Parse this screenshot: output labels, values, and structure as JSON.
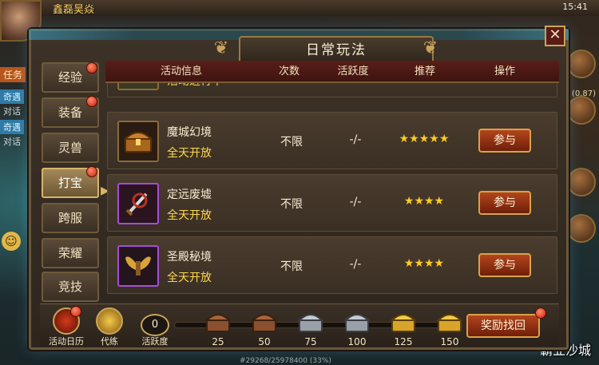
{
  "hud": {
    "player_name": "鑫磊昊焱",
    "clock": "15:41",
    "task_tag": "任务",
    "side_tags": [
      "奇遇",
      "对话",
      "奇遇",
      "对话"
    ],
    "coord": "(0.87)",
    "bottom_progress": "#29268/25978400 (33%)",
    "watermark": "霸业沙城"
  },
  "dialog": {
    "title": "日常玩法",
    "close_symbol": "✕"
  },
  "tabs": [
    {
      "label": "经验",
      "badge": true,
      "active": false
    },
    {
      "label": "装备",
      "badge": true,
      "active": false
    },
    {
      "label": "灵兽",
      "badge": false,
      "active": false
    },
    {
      "label": "打宝",
      "badge": true,
      "active": true
    },
    {
      "label": "跨服",
      "badge": false,
      "active": false
    },
    {
      "label": "荣耀",
      "badge": false,
      "active": false
    },
    {
      "label": "竞技",
      "badge": false,
      "active": false
    }
  ],
  "table": {
    "headers": {
      "info": "活动信息",
      "count": "次数",
      "active": "活跃度",
      "recommend": "推荐",
      "operate": "操作"
    },
    "partial_row": {
      "name": "活动进行中",
      "button": "参与"
    },
    "rows": [
      {
        "name": "魔城幻境",
        "time": "全天开放",
        "count": "不限",
        "active": "-/-",
        "stars": "★★★★★",
        "rating": 5,
        "button": "参与",
        "icon": "chest-icon"
      },
      {
        "name": "定远废墟",
        "time": "全天开放",
        "count": "不限",
        "active": "-/-",
        "stars": "★★★★",
        "rating": 4,
        "button": "参与",
        "icon": "sword-icon"
      },
      {
        "name": "圣殿秘境",
        "time": "全天开放",
        "count": "不限",
        "active": "-/-",
        "stars": "★★★★",
        "rating": 4,
        "button": "参与",
        "icon": "wings-icon"
      }
    ]
  },
  "bottom": {
    "calendar_label": "活动日历",
    "drill_label": "代练",
    "score_value": "0",
    "score_label": "活跃度",
    "chests": [
      {
        "value": "25",
        "tier": "bronze"
      },
      {
        "value": "50",
        "tier": "bronze"
      },
      {
        "value": "75",
        "tier": "silver"
      },
      {
        "value": "100",
        "tier": "silver"
      },
      {
        "value": "125",
        "tier": "gold"
      },
      {
        "value": "150",
        "tier": "gold"
      }
    ],
    "reward_button": "奖励找回"
  },
  "colors": {
    "gold": "#ffcc22",
    "time_text": "#ffd84a",
    "header_bg": "#5a1e18",
    "button_bg": "#b3451c",
    "badge": "#c6200e"
  }
}
